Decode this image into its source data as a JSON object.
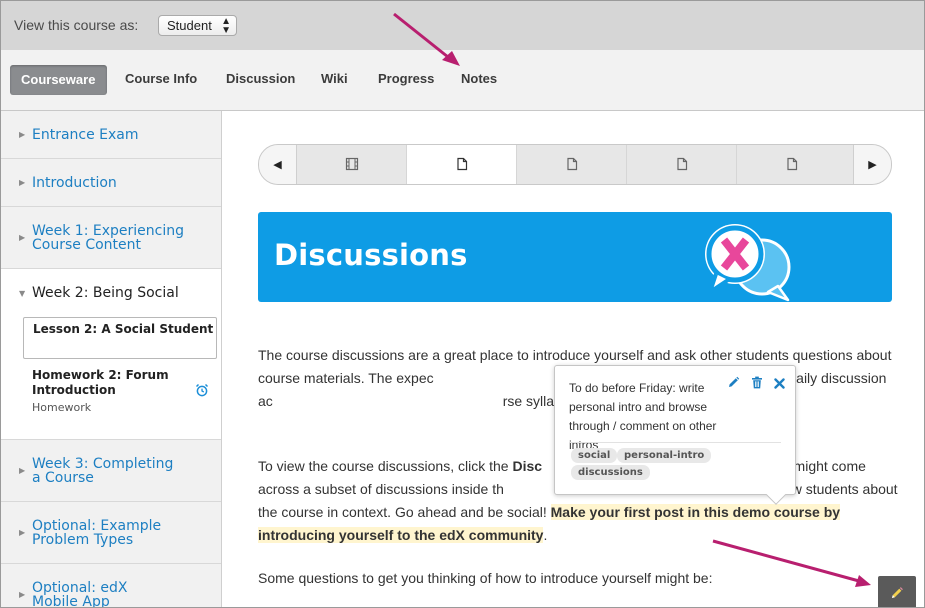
{
  "viewbar": {
    "label": "View this course as:",
    "selected_role": "Student"
  },
  "tabs": [
    {
      "label": "Courseware",
      "active": true
    },
    {
      "label": "Course Info"
    },
    {
      "label": "Discussion"
    },
    {
      "label": "Wiki"
    },
    {
      "label": "Progress"
    },
    {
      "label": "Notes"
    }
  ],
  "sidebar": {
    "chapters": [
      {
        "name": "Entrance Exam"
      },
      {
        "name": "Introduction"
      },
      {
        "name": "Week 1: Experiencing Course Content"
      },
      {
        "name": "Week 2: Being Social",
        "open": true
      },
      {
        "name": "Week 3: Completing a Course"
      },
      {
        "name": "Optional: Example Problem Types"
      },
      {
        "name": "Optional: edX Mobile App"
      }
    ],
    "lesson": {
      "name": "Lesson 2: A Social Student"
    },
    "homework": {
      "name": "Homework 2: Forum Introduction",
      "subtitle": "Homework"
    }
  },
  "sequence": {
    "items": [
      "video",
      "page",
      "page",
      "page",
      "page"
    ],
    "active_index": 1
  },
  "banner": {
    "title": "Discussions",
    "color": "#0e9ce5"
  },
  "content": {
    "para1": "The course discussions are a great place to introduce yourself and ask other students questions about course materials. The expec",
    "para1_cont": "but some courses require weekly or daily discussion ac",
    "para1_end": "rse syllabus for guidance.",
    "para2_a": "To view the course discussions, click the ",
    "para2_bold": "Disc",
    "para2_b": "You might come across a subset of discussions inside th",
    "para2_c": "n talk with fellow students about the course in context. Go ahead and be social! ",
    "para2_highlight": "Make your first post in this demo course by introducing yourself to the edX community",
    "para2_end": ".",
    "para3": "Some questions to get you thinking of how to introduce yourself might be:"
  },
  "note": {
    "text": "To do before Friday: write personal intro and browse through / comment on other intros",
    "tags": [
      "social",
      "personal-intro",
      "discussions"
    ]
  },
  "colors": {
    "link": "#1d7fc2",
    "annotation_arrow": "#b81f6f",
    "highlight": "#fff5cf"
  }
}
